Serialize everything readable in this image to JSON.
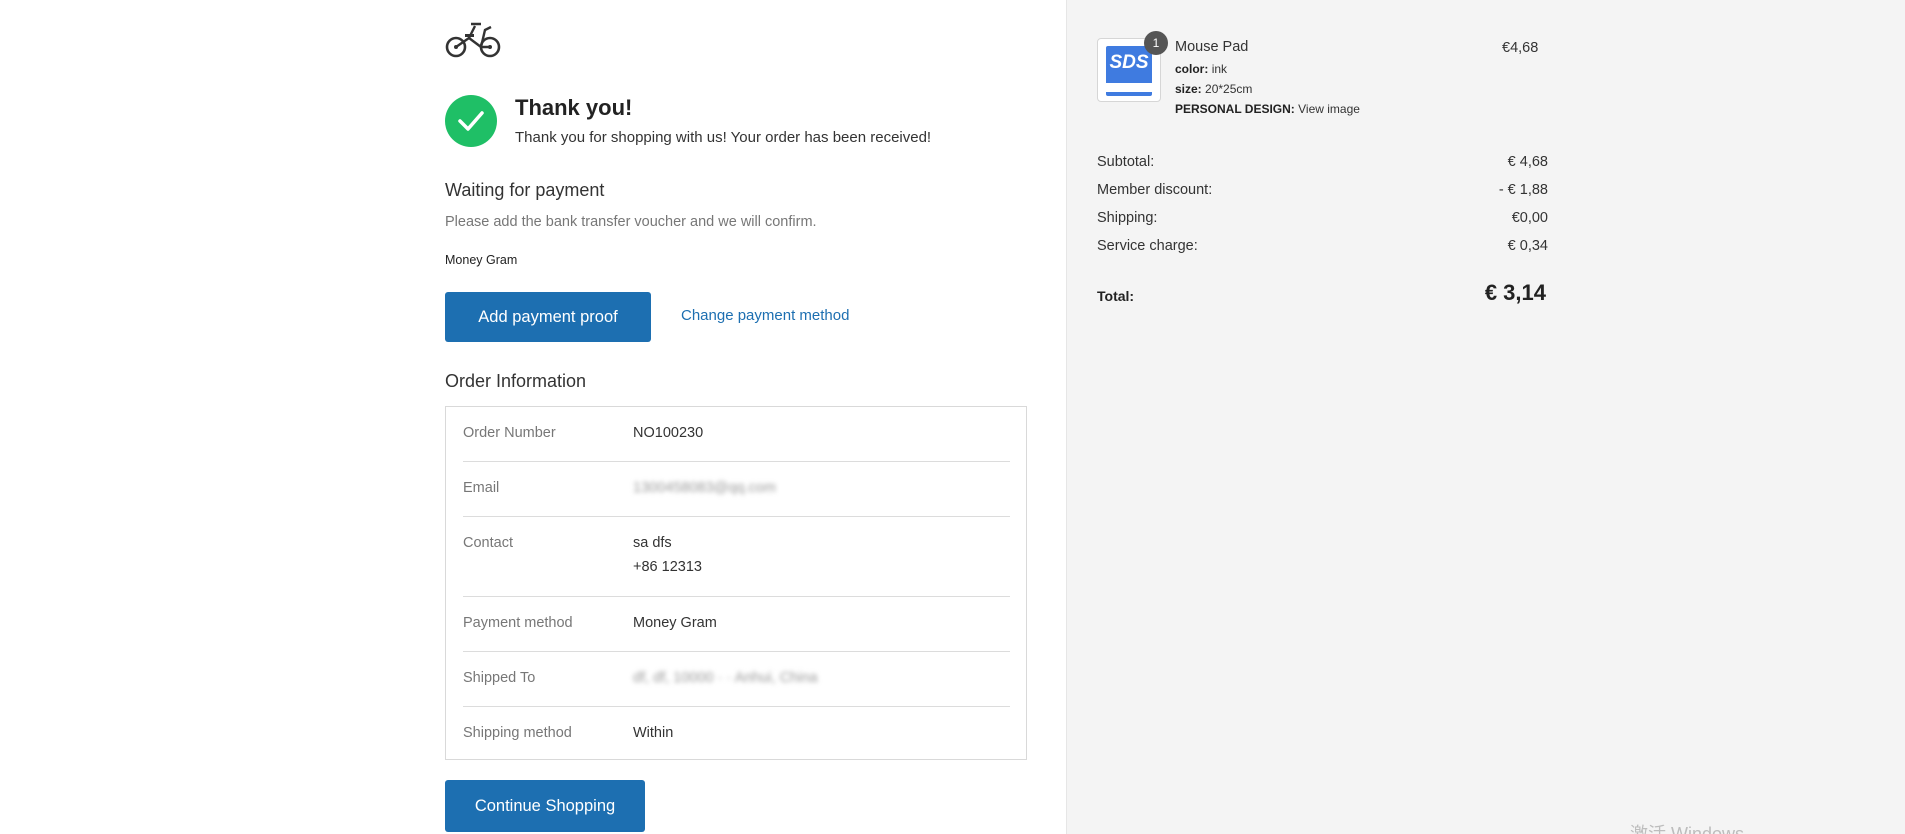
{
  "brand": {
    "logo_icon": "folding-bike-icon"
  },
  "confirmation": {
    "title": "Thank you!",
    "message": "Thank you for shopping with us! Your order has been received!",
    "icon": "check-icon",
    "icon_color": "#1fbf66"
  },
  "payment": {
    "status_title": "Waiting for payment",
    "instruction": "Please add the bank transfer voucher and we will confirm.",
    "method_name": "Money Gram",
    "add_proof_label": "Add payment proof",
    "change_method_label": "Change payment method"
  },
  "order_info": {
    "title": "Order Information",
    "rows": [
      {
        "label": "Order Number",
        "value": "NO100230"
      },
      {
        "label": "Email",
        "value": "1300458083@qq.com"
      },
      {
        "label": "Contact",
        "value": "sa dfs",
        "value2": "+86 12313"
      },
      {
        "label": "Payment method",
        "value": "Money Gram"
      },
      {
        "label": "Shipped To",
        "value": "df, df, 10000 · · Anhui, China"
      },
      {
        "label": "Shipping method",
        "value": "Within"
      }
    ]
  },
  "continue_label": "Continue Shopping",
  "summary": {
    "item": {
      "name": "Mouse Pad",
      "price": "€4,68",
      "quantity": "1",
      "thumb_text": "SDS",
      "attributes": [
        {
          "key": "color:",
          "value": "ink"
        },
        {
          "key": "size:",
          "value": "20*25cm"
        },
        {
          "key": "PERSONAL DESIGN:",
          "value": "View image"
        }
      ]
    },
    "rows": [
      {
        "label": "Subtotal:",
        "value": "€ 4,68"
      },
      {
        "label": "Member discount:",
        "value": "- € 1,88"
      },
      {
        "label": "Shipping:",
        "value": "€0,00"
      },
      {
        "label": "Service charge:",
        "value": "€ 0,34"
      }
    ],
    "total_label": "Total:",
    "total_value": "€ 3,14"
  },
  "watermark": "激活 Windows",
  "colors": {
    "accent": "#1d6fb1",
    "success": "#1fbf66",
    "sidebar_bg": "#f4f4f4"
  }
}
